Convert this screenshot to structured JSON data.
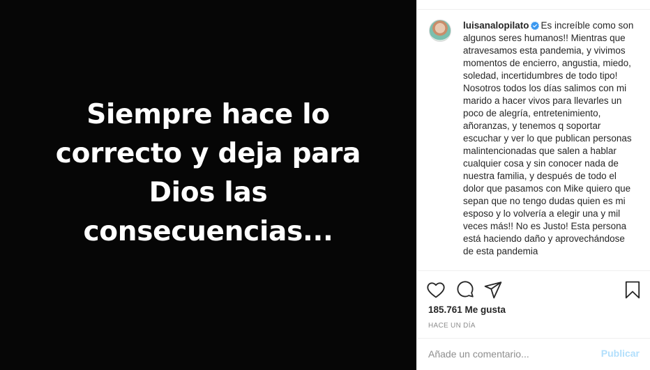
{
  "media": {
    "text": "Siempre hace lo correcto y deja para Dios las consecuencias..."
  },
  "post": {
    "username": "luisanalopilato",
    "caption": "Es increíble como son algunos seres humanos!! Mientras que atravesamos esta pandemia, y vivimos momentos de encierro, angustia, miedo, soledad, incertidumbres de todo tipo! Nosotros todos los días salimos con mi marido a hacer vivos para llevarles un poco de alegría, entretenimiento, añoranzas, y tenemos q soportar escuchar y ver lo que publican personas malintencionadas que salen a hablar cualquier cosa y sin conocer nada de nuestra familia, y después de todo el dolor que pasamos con Mike quiero que sepan que no tengo dudas quien es mi esposo y lo volvería a elegir una y mil veces más!! No es Justo! Esta persona está haciendo daño y aprovechándose de esta pandemia",
    "likes": "185.761 Me gusta",
    "time": "HACE UN DÍA"
  },
  "comment": {
    "placeholder": "Añade un comentario...",
    "post_label": "Publicar"
  },
  "colors": {
    "verified": "#3897f0",
    "post_button": "#b2dffc",
    "secondary_text": "#8e8e8e"
  },
  "icons": [
    "heart-icon",
    "comment-icon",
    "share-icon",
    "bookmark-icon",
    "verified-icon"
  ]
}
